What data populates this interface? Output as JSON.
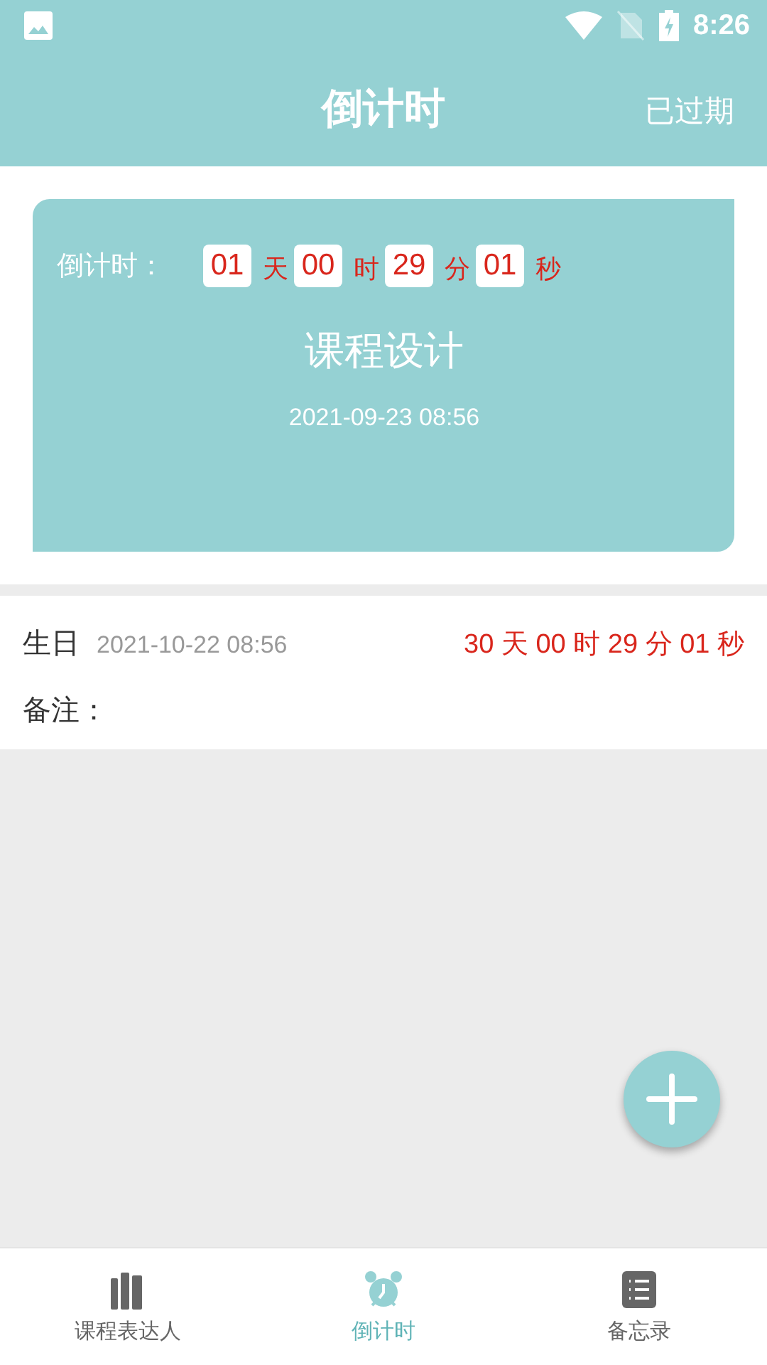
{
  "status_bar": {
    "time": "8:26"
  },
  "app_bar": {
    "title": "倒计时",
    "action": "已过期"
  },
  "featured": {
    "label": "倒计时：",
    "units": [
      {
        "value": "01",
        "unit": "天"
      },
      {
        "value": "00",
        "unit": "时"
      },
      {
        "value": "29",
        "unit": "分"
      },
      {
        "value": "01",
        "unit": "秒"
      }
    ],
    "name": "课程设计",
    "date": "2021-09-23 08:56"
  },
  "events": [
    {
      "name": "生日",
      "date": "2021-10-22 08:56",
      "remaining": [
        {
          "value": "30",
          "unit": "天"
        },
        {
          "value": "00",
          "unit": "时"
        },
        {
          "value": "29",
          "unit": "分"
        },
        {
          "value": "01",
          "unit": "秒"
        }
      ],
      "note_label": "备注："
    }
  ],
  "bottom_nav": [
    {
      "kind": "books",
      "label": "课程表达人",
      "selected": false
    },
    {
      "kind": "alarm",
      "label": "倒计时",
      "selected": true
    },
    {
      "kind": "list",
      "label": "备忘录",
      "selected": false
    }
  ]
}
